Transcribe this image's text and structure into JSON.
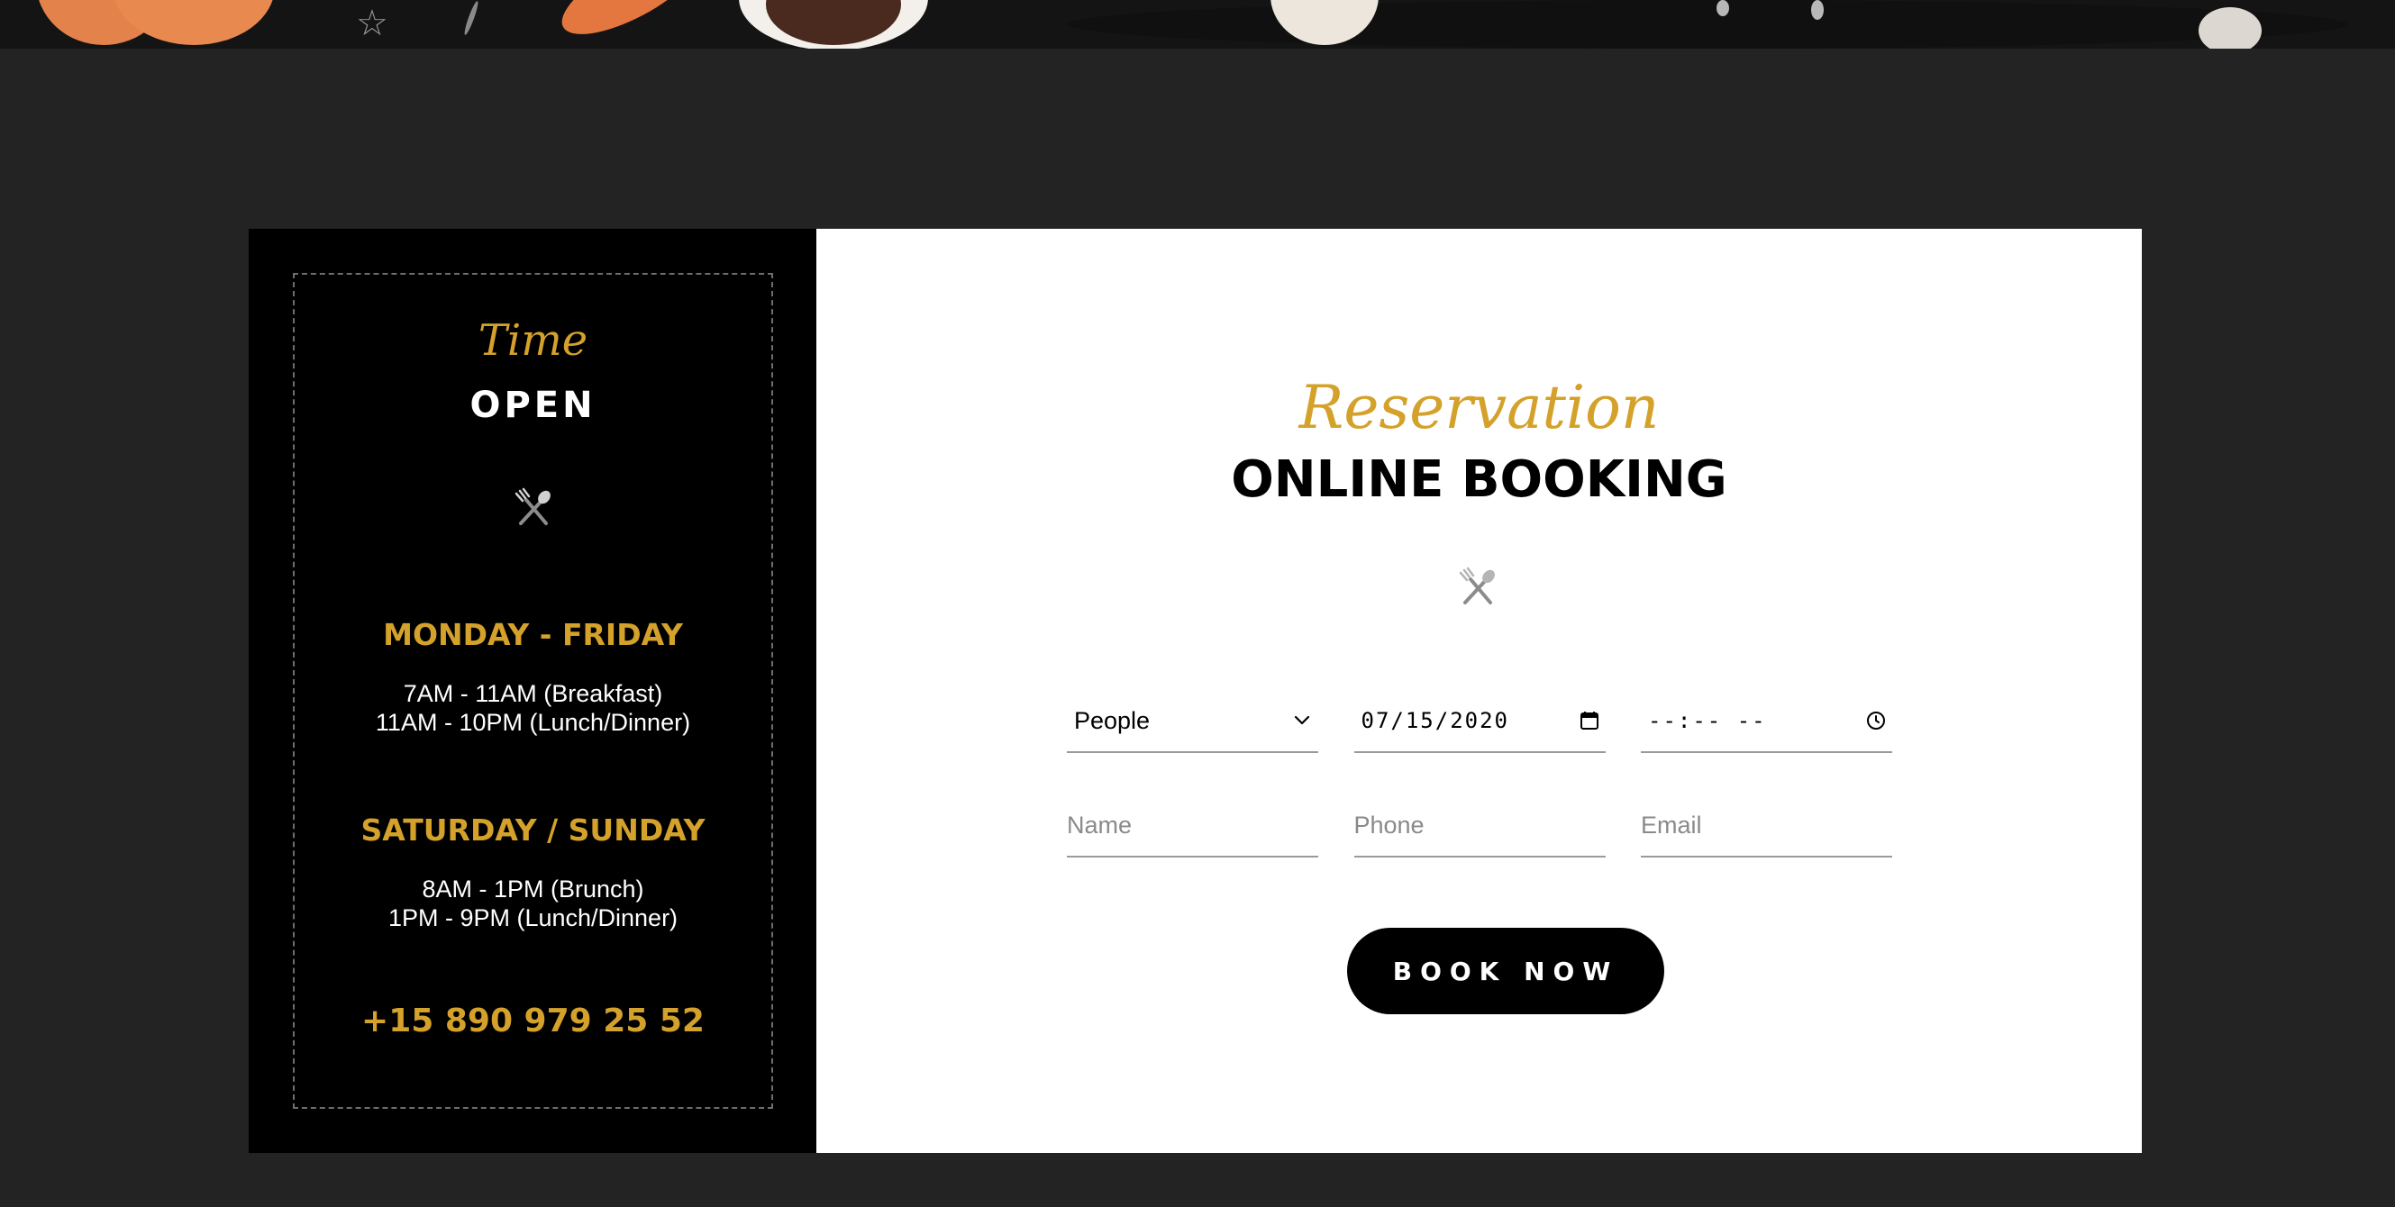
{
  "colors": {
    "page_background": "#232323",
    "accent_gold": "#d4a12a",
    "panel_dark": "#000000",
    "panel_light": "#ffffff"
  },
  "hours": {
    "script_title": "Time",
    "heading": "OPEN",
    "icon": "utensils-icon",
    "weekday_label": "MONDAY - FRIDAY",
    "weekday_times": [
      "7AM - 11AM (Breakfast)",
      "11AM - 10PM (Lunch/Dinner)"
    ],
    "weekend_label": "SATURDAY / SUNDAY",
    "weekend_times": [
      "8AM - 1PM (Brunch)",
      "1PM - 9PM (Lunch/Dinner)"
    ],
    "phone": "+15 890 979 25 52"
  },
  "booking": {
    "script_title": "Reservation",
    "heading": "ONLINE BOOKING",
    "icon": "utensils-icon",
    "people_select": {
      "value": "People",
      "icon": "chevron-down-icon"
    },
    "date_field": {
      "value": "07/15/2020",
      "icon": "calendar-icon"
    },
    "time_field": {
      "value": "--:-- --",
      "icon": "clock-icon"
    },
    "name_placeholder": "Name",
    "phone_placeholder": "Phone",
    "email_placeholder": "Email",
    "button_label": "BOOK NOW"
  }
}
